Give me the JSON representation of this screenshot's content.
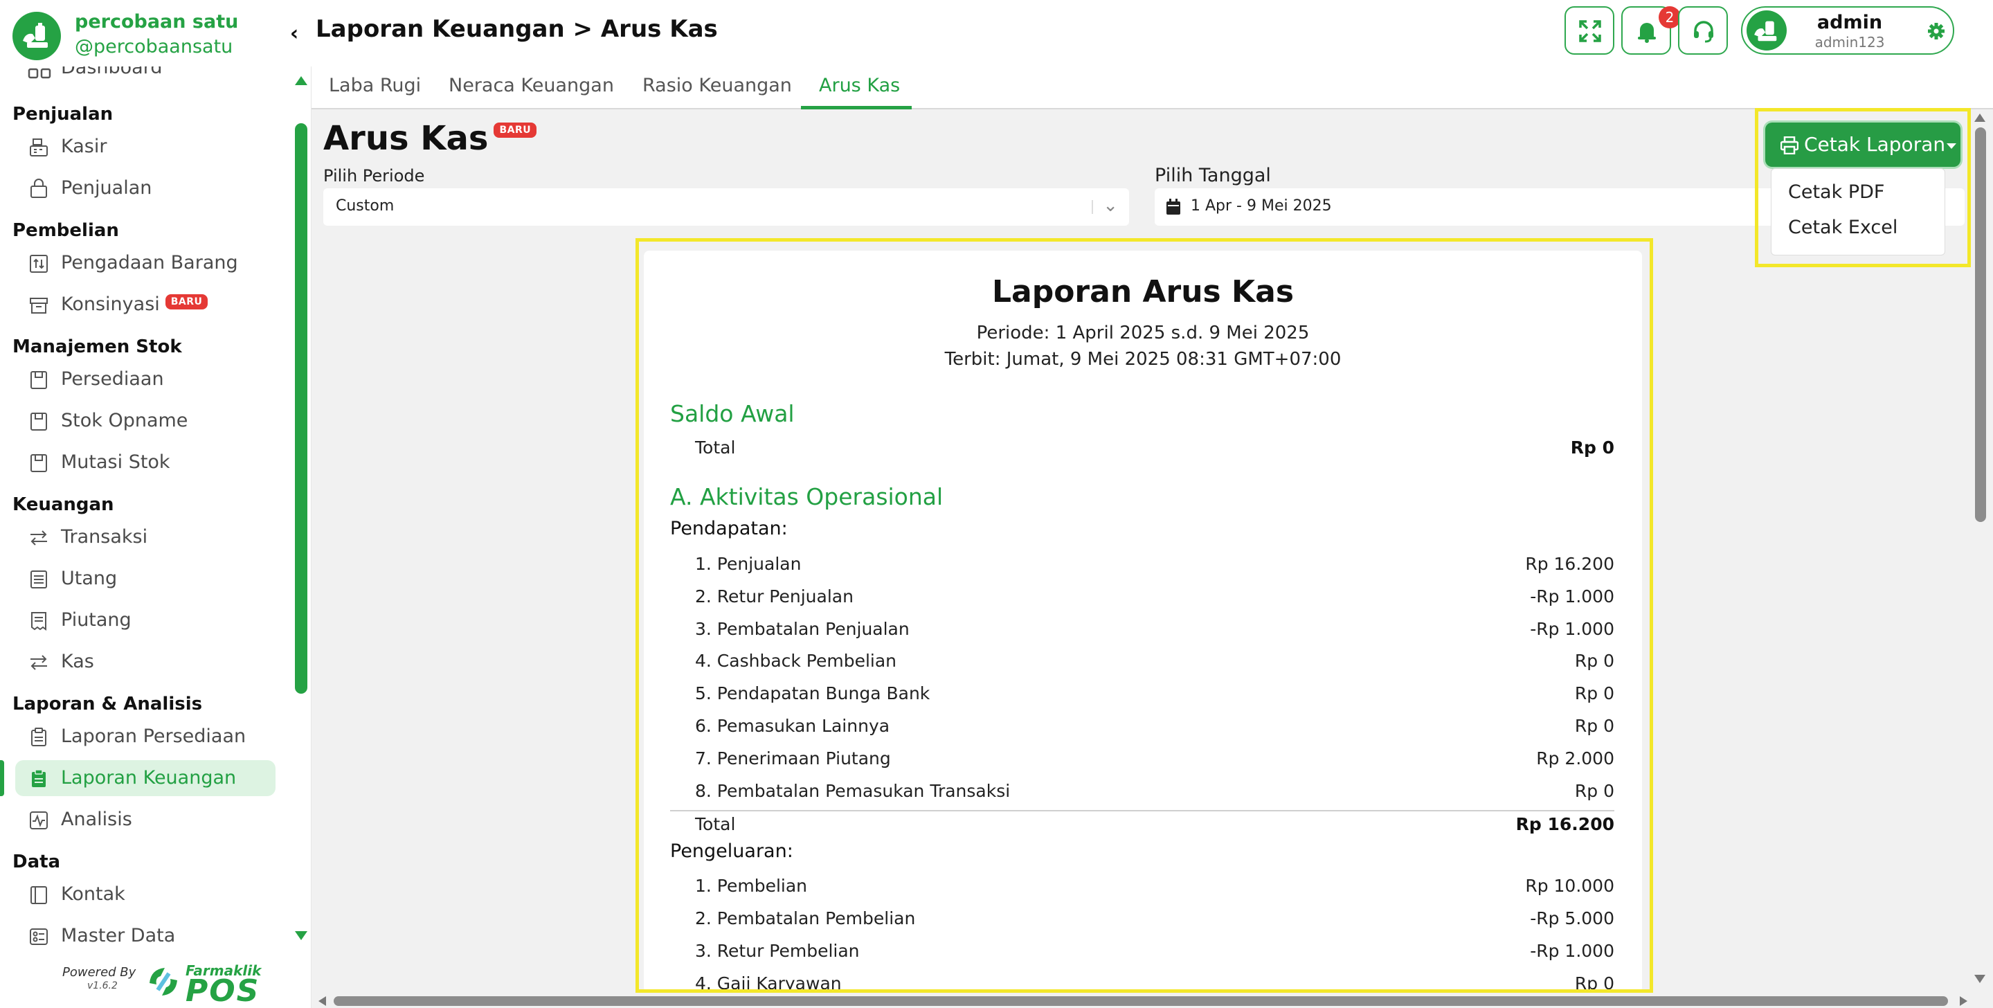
{
  "brand": {
    "name": "percobaan satu",
    "handle": "@percobaansatu"
  },
  "sidebar": {
    "cut_item": "Dashboard",
    "sections": {
      "penjualan": "Penjualan",
      "pembelian": "Pembelian",
      "stok": "Manajemen Stok",
      "keuangan": "Keuangan",
      "laporan": "Laporan & Analisis",
      "data": "Data"
    },
    "items": {
      "kasir": "Kasir",
      "penjualan": "Penjualan",
      "pengadaan": "Pengadaan Barang",
      "konsinyasi": "Konsinyasi",
      "persediaan": "Persediaan",
      "stok_opname": "Stok Opname",
      "mutasi_stok": "Mutasi Stok",
      "transaksi": "Transaksi",
      "utang": "Utang",
      "piutang": "Piutang",
      "kas": "Kas",
      "laporan_persediaan": "Laporan Persediaan",
      "laporan_keuangan": "Laporan Keuangan",
      "analisis": "Analisis",
      "kontak": "Kontak",
      "master_data": "Master Data"
    },
    "badge_new": "BARU",
    "powered_by": "Powered By",
    "version": "v1.6.2",
    "logo_small": "Farmaklik",
    "logo_big": "POS"
  },
  "header": {
    "breadcrumb": "Laporan Keuangan > Arus Kas",
    "notification_count": "2",
    "user_name": "admin",
    "user_id": "admin123"
  },
  "tabs": [
    "Laba Rugi",
    "Neraca Keuangan",
    "Rasio Keuangan",
    "Arus Kas"
  ],
  "page": {
    "title": "Arus Kas",
    "badge": "BARU",
    "period_label": "Pilih Periode",
    "period_value": "Custom",
    "date_label": "Pilih Tanggal",
    "date_value": "1 Apr - 9 Mei 2025"
  },
  "print": {
    "button": "Cetak Laporan",
    "options": [
      "Cetak PDF",
      "Cetak Excel"
    ]
  },
  "report": {
    "title": "Laporan Arus Kas",
    "period": "Periode: 1 April 2025 s.d. 9 Mei 2025",
    "issued": "Terbit: Jumat, 9 Mei 2025 08:31 GMT+07:00",
    "saldo_awal": {
      "heading": "Saldo Awal",
      "label": "Total",
      "value": "Rp 0"
    },
    "operasional": {
      "heading": "A. Aktivitas Operasional",
      "pendapatan_label": "Pendapatan:",
      "pendapatan": [
        {
          "label": "1. Penjualan",
          "value": "Rp 16.200"
        },
        {
          "label": "2. Retur Penjualan",
          "value": "-Rp 1.000"
        },
        {
          "label": "3. Pembatalan Penjualan",
          "value": "-Rp 1.000"
        },
        {
          "label": "4. Cashback Pembelian",
          "value": "Rp 0"
        },
        {
          "label": "5. Pendapatan Bunga Bank",
          "value": "Rp 0"
        },
        {
          "label": "6. Pemasukan Lainnya",
          "value": "Rp 0"
        },
        {
          "label": "7. Penerimaan Piutang",
          "value": "Rp 2.000"
        },
        {
          "label": "8. Pembatalan Pemasukan Transaksi",
          "value": "Rp 0"
        }
      ],
      "pendapatan_total_label": "Total",
      "pendapatan_total": "Rp 16.200",
      "pengeluaran_label": "Pengeluaran:",
      "pengeluaran": [
        {
          "label": "1. Pembelian",
          "value": "Rp 10.000"
        },
        {
          "label": "2. Pembatalan Pembelian",
          "value": "-Rp 5.000"
        },
        {
          "label": "3. Retur Pembelian",
          "value": "-Rp 1.000"
        },
        {
          "label": "4. Gaji Karyawan",
          "value": "Rp 0"
        }
      ]
    }
  },
  "colors": {
    "accent": "#25a244",
    "highlight": "#f3e72a",
    "badge": "#e53935"
  }
}
